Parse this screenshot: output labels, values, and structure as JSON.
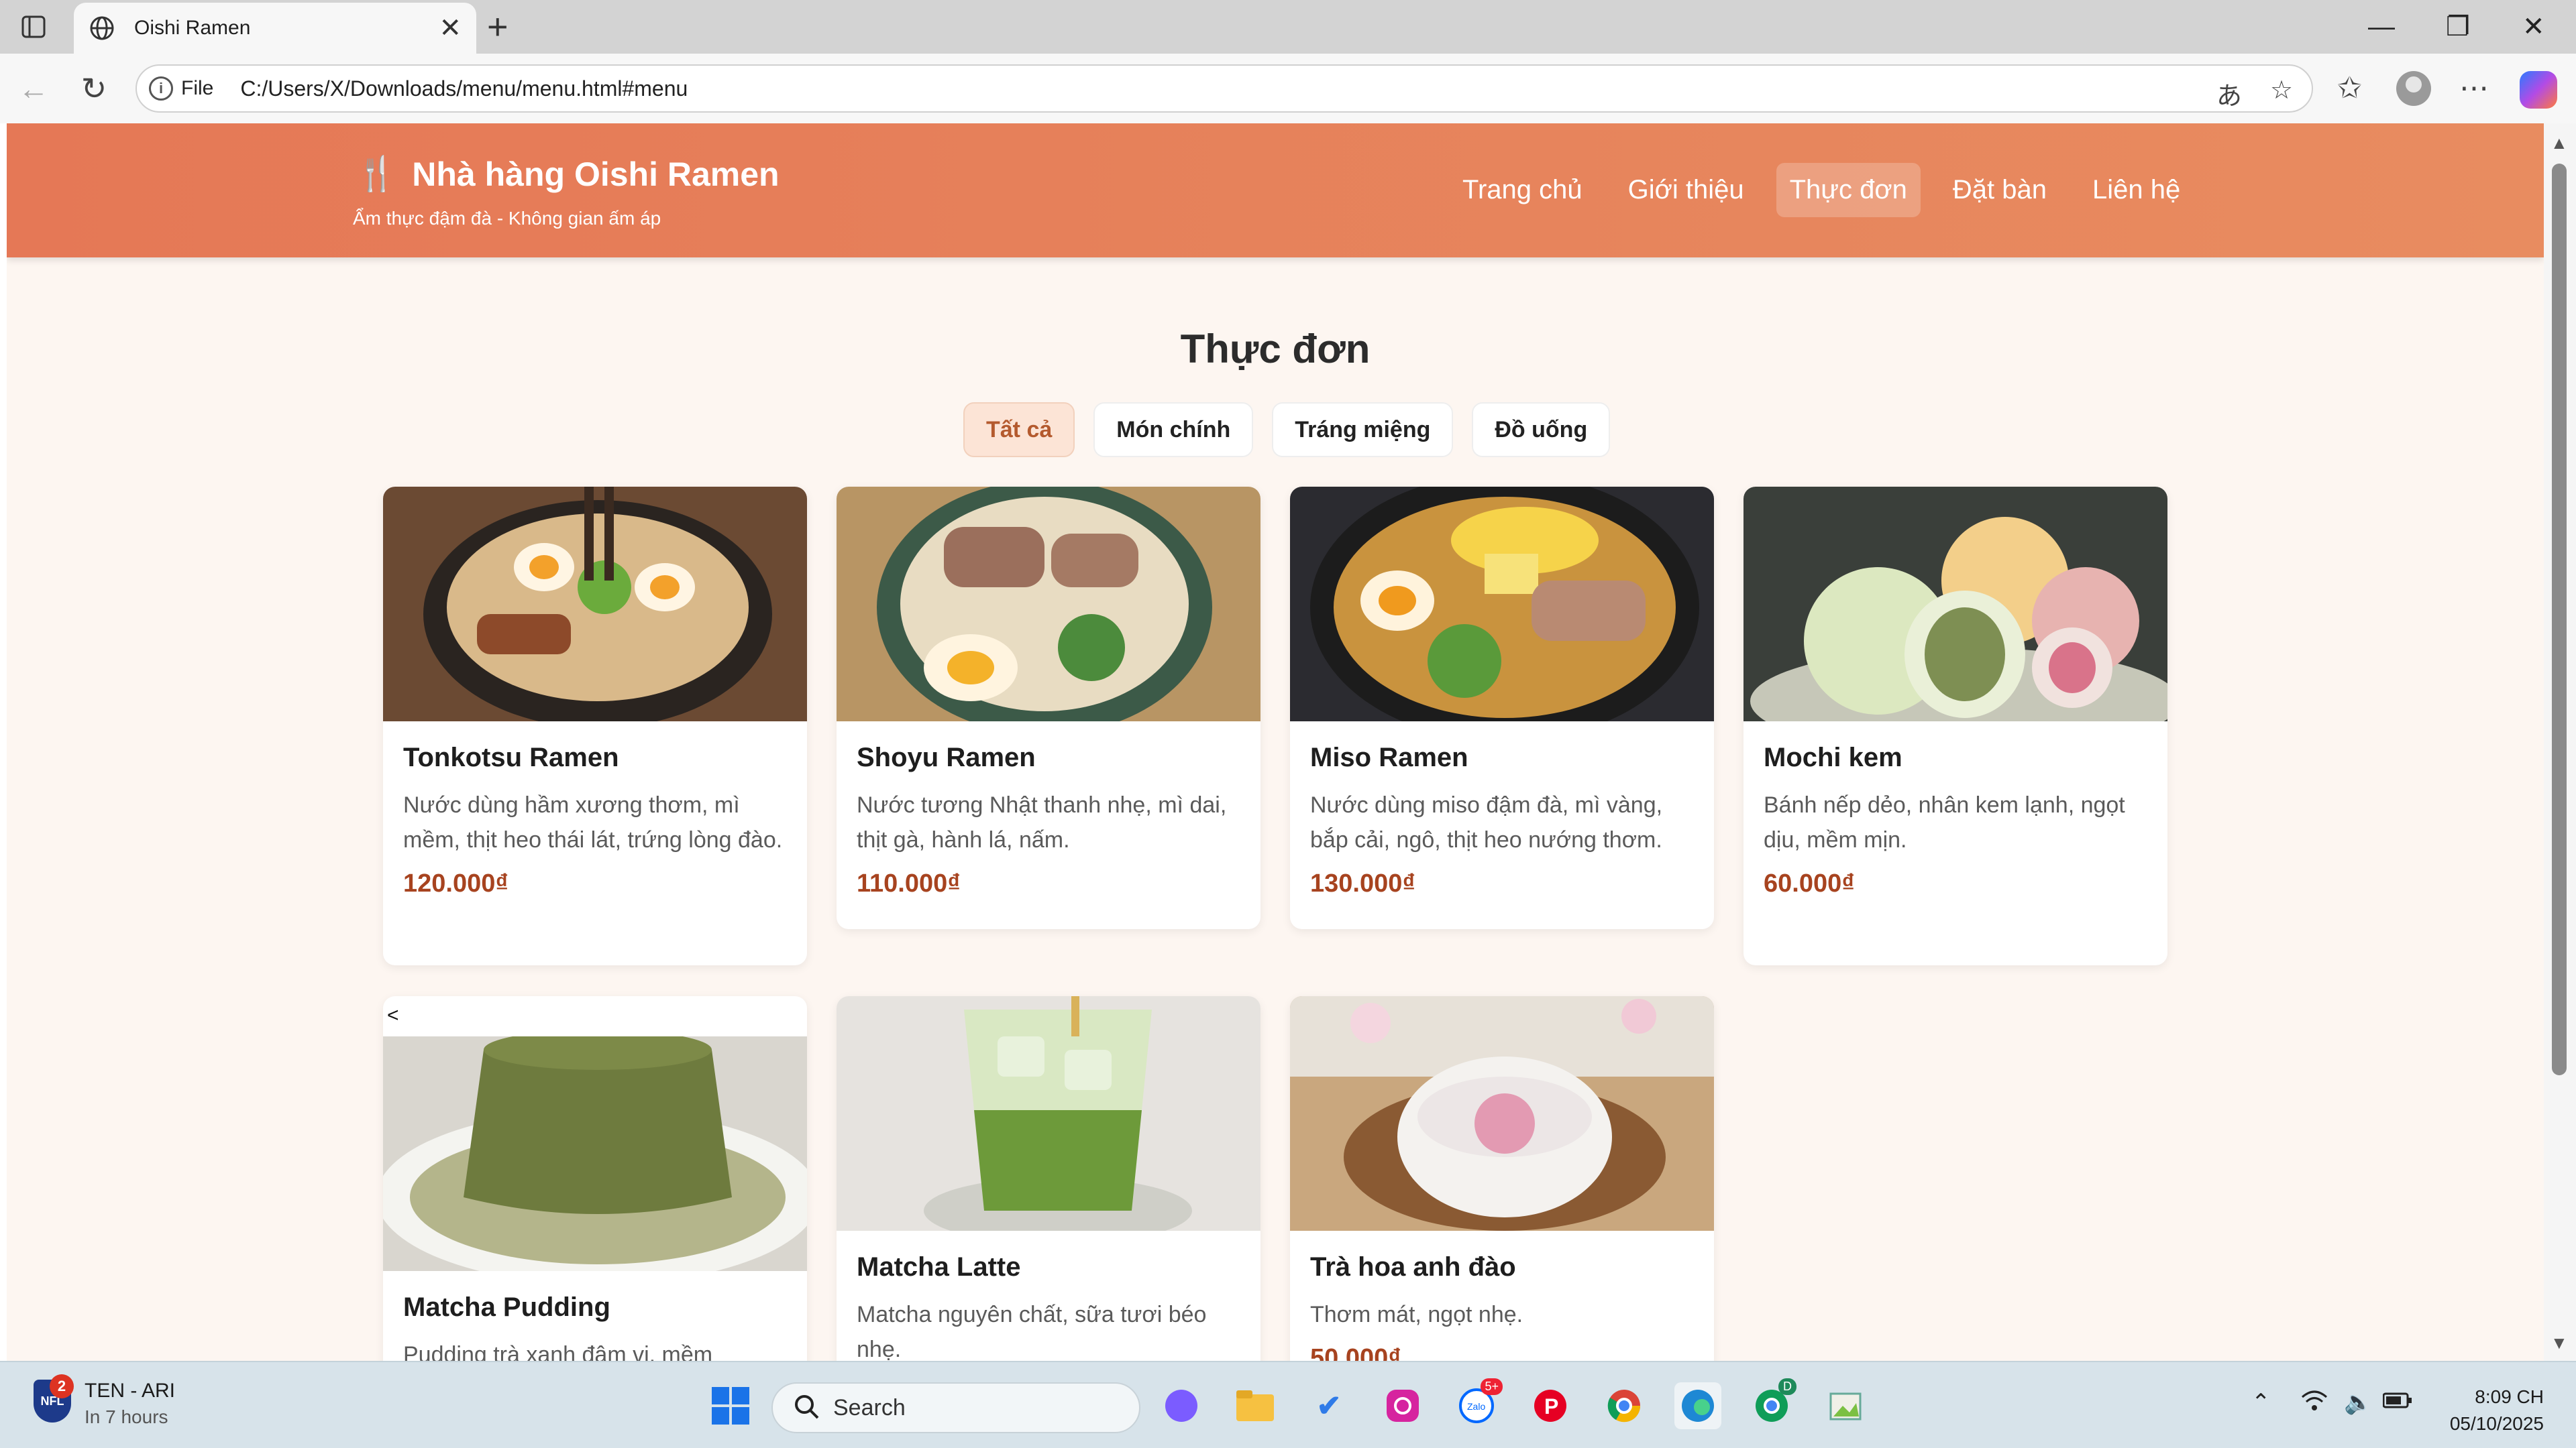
{
  "browser": {
    "tab_title": "Oishi Ramen",
    "file_label": "File",
    "url": "C:/Users/X/Downloads/menu/menu.html#menu"
  },
  "site": {
    "brand_icon": "🍴",
    "brand": "Nhà hàng Oishi Ramen",
    "tagline": "Ẩm thực đậm đà - Không gian ấm áp",
    "nav": [
      "Trang chủ",
      "Giới thiệu",
      "Thực đơn",
      "Đặt bàn",
      "Liên hệ"
    ],
    "active_nav": "Thực đơn",
    "accent": "#e57856"
  },
  "menu": {
    "title": "Thực đơn",
    "filters": [
      "Tất cả",
      "Món chính",
      "Tráng miệng",
      "Đồ uống"
    ],
    "active_filter": "Tất cả",
    "items": [
      {
        "name": "Tonkotsu Ramen",
        "desc": "Nước dùng hầm xương thơm, mì mềm, thịt heo thái lát, trứng lòng đào.",
        "price": "120.000₫"
      },
      {
        "name": "Shoyu Ramen",
        "desc": "Nước tương Nhật thanh nhẹ, mì dai, thịt gà, hành lá, nấm.",
        "price": "110.000₫"
      },
      {
        "name": "Miso Ramen",
        "desc": "Nước dùng miso đậm đà, mì vàng, bắp cải, ngô, thịt heo nướng thơm.",
        "price": "130.000₫"
      },
      {
        "name": "Mochi kem",
        "desc": "Bánh nếp dẻo, nhân kem lạnh, ngọt dịu, mềm mịn.",
        "price": "60.000₫"
      },
      {
        "name": "Matcha Pudding",
        "desc": "Pudding trà xanh đậm vị, mềm",
        "price": "",
        "broken_prefix": "<"
      },
      {
        "name": "Matcha Latte",
        "desc": "Matcha nguyên chất, sữa tươi béo nhẹ.",
        "price": ""
      },
      {
        "name": "Trà hoa anh đào",
        "desc": "Thơm mát, ngọt nhẹ.",
        "price": "50.000₫"
      }
    ]
  },
  "taskbar": {
    "weather_title": "TEN - ARI",
    "weather_sub": "In 7 hours",
    "nfl_badge": "2",
    "search_label": "Search",
    "zalo_badge": "5+",
    "chrome_badge": "D",
    "time": "8:09 CH",
    "date": "05/10/2025"
  }
}
